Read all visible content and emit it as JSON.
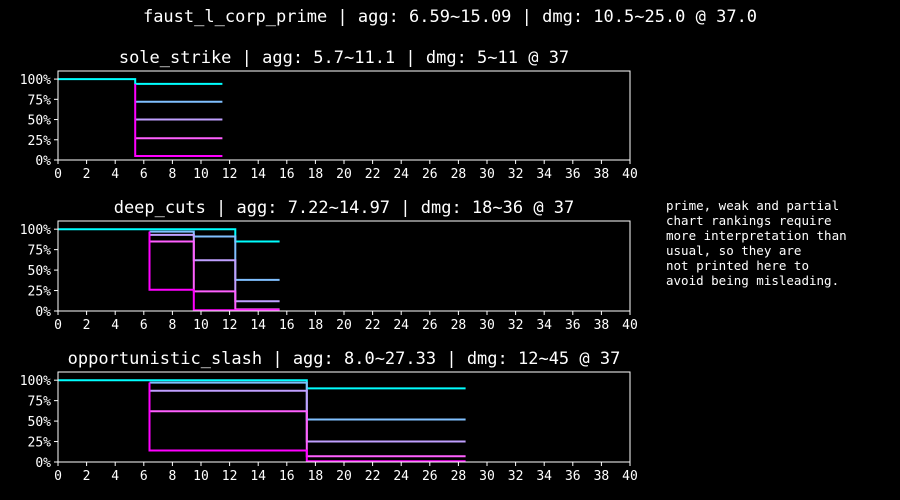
{
  "suptitle": "faust_l_corp_prime | agg: 6.59~15.09 | dmg: 10.5~25.0 @ 37.0",
  "note": "prime, weak and partial\nchart rankings require\nmore interpretation than\nusual, so they are\nnot printed here to\navoid being misleading.",
  "colors": {
    "background": "#000000",
    "axes": "#ffffff",
    "series": [
      "#00ffff",
      "#80c0ff",
      "#c0a0ff",
      "#ff60ff",
      "#ff00ff"
    ]
  },
  "chart_data": [
    {
      "type": "line",
      "step": true,
      "title": "sole_strike | agg: 5.7~11.1 | dmg: 5~11 @ 37",
      "xlim": [
        0,
        40
      ],
      "ylim": [
        0,
        1.1
      ],
      "xticks": [
        0,
        2,
        4,
        6,
        8,
        10,
        12,
        14,
        16,
        18,
        20,
        22,
        24,
        26,
        28,
        30,
        32,
        34,
        36,
        38,
        40
      ],
      "yticks": [
        0,
        0.25,
        0.5,
        0.75,
        1.0
      ],
      "ytick_labels": [
        "0%",
        "25%",
        "50%",
        "75%",
        "100%"
      ],
      "series": [
        {
          "x": [
            0,
            5.4,
            5.4,
            11.5
          ],
          "y": [
            1.0,
            1.0,
            0.94,
            0.94
          ]
        },
        {
          "x": [
            5.4,
            11.5
          ],
          "y": [
            0.72,
            0.72
          ]
        },
        {
          "x": [
            5.4,
            11.5
          ],
          "y": [
            0.5,
            0.5
          ]
        },
        {
          "x": [
            5.4,
            11.5
          ],
          "y": [
            0.27,
            0.27
          ]
        },
        {
          "x": [
            5.4,
            5.4,
            11.5
          ],
          "y": [
            0.94,
            0.05,
            0.05
          ]
        }
      ]
    },
    {
      "type": "line",
      "step": true,
      "title": "deep_cuts | agg: 7.22~14.97 | dmg: 18~36 @ 37",
      "xlim": [
        0,
        40
      ],
      "ylim": [
        0,
        1.1
      ],
      "xticks": [
        0,
        2,
        4,
        6,
        8,
        10,
        12,
        14,
        16,
        18,
        20,
        22,
        24,
        26,
        28,
        30,
        32,
        34,
        36,
        38,
        40
      ],
      "yticks": [
        0,
        0.25,
        0.5,
        0.75,
        1.0
      ],
      "ytick_labels": [
        "0%",
        "25%",
        "50%",
        "75%",
        "100%"
      ],
      "series": [
        {
          "x": [
            0,
            12.4,
            12.4,
            15.5
          ],
          "y": [
            1.0,
            1.0,
            0.85,
            0.85
          ]
        },
        {
          "x": [
            6.4,
            9.5,
            9.5,
            12.4,
            12.4,
            15.5
          ],
          "y": [
            0.97,
            0.97,
            0.91,
            0.91,
            0.38,
            0.38
          ]
        },
        {
          "x": [
            6.4,
            9.5,
            9.5,
            12.4,
            12.4,
            15.5
          ],
          "y": [
            0.93,
            0.93,
            0.62,
            0.62,
            0.12,
            0.12
          ]
        },
        {
          "x": [
            6.4,
            9.5,
            9.5,
            12.4,
            12.4,
            15.5
          ],
          "y": [
            0.85,
            0.85,
            0.24,
            0.24,
            0.02,
            0.02
          ]
        },
        {
          "x": [
            6.4,
            6.4,
            9.5,
            9.5,
            15.5
          ],
          "y": [
            0.97,
            0.26,
            0.26,
            0.01,
            0.01
          ]
        }
      ]
    },
    {
      "type": "line",
      "step": true,
      "title": "opportunistic_slash | agg: 8.0~27.33 | dmg: 12~45 @ 37",
      "xlim": [
        0,
        40
      ],
      "ylim": [
        0,
        1.1
      ],
      "xticks": [
        0,
        2,
        4,
        6,
        8,
        10,
        12,
        14,
        16,
        18,
        20,
        22,
        24,
        26,
        28,
        30,
        32,
        34,
        36,
        38,
        40
      ],
      "yticks": [
        0,
        0.25,
        0.5,
        0.75,
        1.0
      ],
      "ytick_labels": [
        "0%",
        "25%",
        "50%",
        "75%",
        "100%"
      ],
      "series": [
        {
          "x": [
            0,
            17.4,
            17.4,
            28.5
          ],
          "y": [
            1.0,
            1.0,
            0.9,
            0.9
          ]
        },
        {
          "x": [
            6.4,
            17.4,
            17.4,
            28.5
          ],
          "y": [
            0.97,
            0.97,
            0.52,
            0.52
          ]
        },
        {
          "x": [
            6.4,
            17.4,
            17.4,
            28.5
          ],
          "y": [
            0.87,
            0.87,
            0.25,
            0.25
          ]
        },
        {
          "x": [
            6.4,
            17.4,
            17.4,
            28.5
          ],
          "y": [
            0.62,
            0.62,
            0.07,
            0.07
          ]
        },
        {
          "x": [
            6.4,
            6.4,
            17.4,
            17.4,
            28.5
          ],
          "y": [
            0.97,
            0.14,
            0.14,
            0.01,
            0.01
          ]
        }
      ]
    }
  ]
}
